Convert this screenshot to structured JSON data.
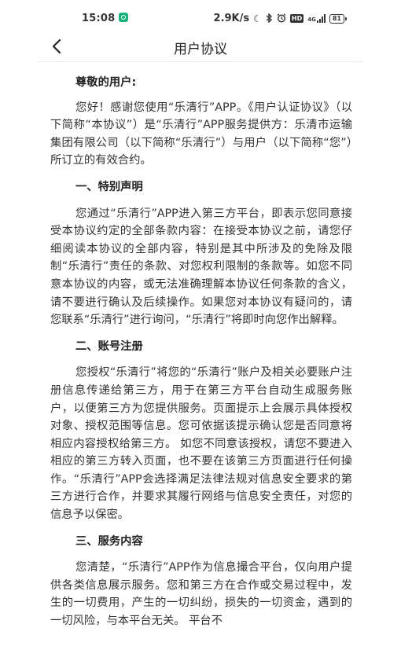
{
  "status_bar": {
    "time": "15:08",
    "net_speed": "2.9K/s",
    "network": "4G",
    "battery": "81"
  },
  "nav": {
    "title": "用户协议",
    "back_icon": "chevron-left-icon"
  },
  "document": {
    "greeting": "尊敬的用户:",
    "intro": "您好！感谢您使用“乐清行”APP。《用户认证协议》（以下简称“本协议”）是“乐清行”APP服务提供方：乐清市运输集团有限公司（以下简称“乐清行”）与用户（以下简称“您”）所订立的有效合约。",
    "sections": [
      {
        "heading": "一、特别声明",
        "body": "您通过“乐清行”APP进入第三方平台，即表示您同意接受本协议约定的全部条款内容：在接受本协议之前，请您仔细阅读本协议的全部内容，特别是其中所涉及的免除及限制“乐清行”责任的条款、对您权利限制的条款等。如您不同意本协议的内容，或无法准确理解本协议任何条款的含义，请不要进行确认及后续操作。如果您对本协议有疑问的，请您联系“乐清行”进行询问，“乐清行”将即时向您作出解释。"
      },
      {
        "heading": "二、账号注册",
        "body": "您授权“乐清行”将您的“乐清行”账户及相关必要账户注册信息传递给第三方，用于在第三方平台自动生成服务账户，以便第三方为您提供服务。页面提示上会展示具体授权对象、授权范围等信息。您可依据该提示确认您是否同意将相应内容授权给第三方。 如您不同意该授权，请您不要进入相应的第三方转入页面，也不要在该第三方页面进行任何操作。“乐清行”APP会选择满足法律法规对信息安全要求的第三方进行合作，并要求其履行网络与信息安全责任，对您的信息予以保密。"
      },
      {
        "heading": "三、服务内容",
        "body": "您清楚，“乐清行”APP作为信息撮合平台，仅向用户提供各类信息展示服务。您和第三方在合作或交易过程中，发生的一切费用，产生的一切纠纷，损失的一切资金，遇到的一切风险，与本平台无关。 平台不"
      }
    ]
  }
}
